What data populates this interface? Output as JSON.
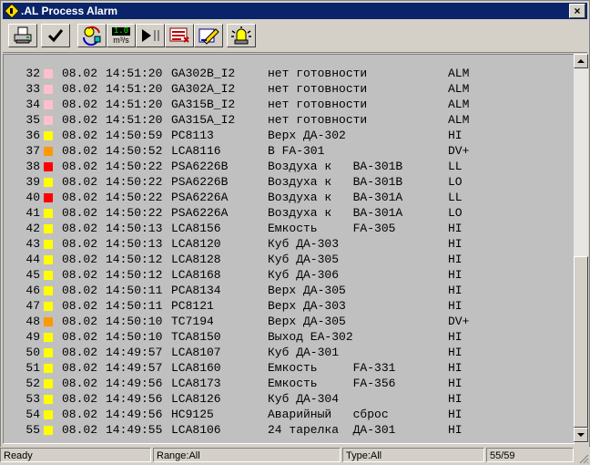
{
  "window": {
    "title": ".AL Process Alarm",
    "close_label": "×"
  },
  "toolbar": {
    "buttons": [
      {
        "name": "print-button",
        "icon": "printer-icon"
      },
      {
        "name": "acknowledge-button",
        "icon": "checkmark-icon"
      },
      {
        "name": "refresh-button",
        "icon": "rotate-arrows-icon"
      },
      {
        "name": "units-button",
        "icon": "units-display-icon",
        "value": "1.0",
        "unit": "m³/s"
      },
      {
        "name": "play-pause-button",
        "icon": "play-pause-icon"
      },
      {
        "name": "alarm-list-button",
        "icon": "list-icon"
      },
      {
        "name": "edit-button",
        "icon": "pencil-icon"
      },
      {
        "name": "alarm-lamp-button",
        "icon": "beacon-icon"
      }
    ]
  },
  "colors": {
    "pink": "#ffc0cb",
    "yellow": "#ffff00",
    "orange": "#ff9900",
    "red": "#ff0000"
  },
  "alarms": [
    {
      "num": "32",
      "color": "pink",
      "date": "08.02",
      "time": "14:51:20",
      "tag": "GA302B_I2",
      "desc": "нет готовности",
      "state": "ALM"
    },
    {
      "num": "33",
      "color": "pink",
      "date": "08.02",
      "time": "14:51:20",
      "tag": "GA302A_I2",
      "desc": "нет готовности",
      "state": "ALM"
    },
    {
      "num": "34",
      "color": "pink",
      "date": "08.02",
      "time": "14:51:20",
      "tag": "GA315B_I2",
      "desc": "нет готовности",
      "state": "ALM"
    },
    {
      "num": "35",
      "color": "pink",
      "date": "08.02",
      "time": "14:51:20",
      "tag": "GA315A_I2",
      "desc": "нет готовности",
      "state": "ALM"
    },
    {
      "num": "36",
      "color": "yellow",
      "date": "08.02",
      "time": "14:50:59",
      "tag": "PC8113",
      "desc": "Верх ДА-302",
      "state": "HI"
    },
    {
      "num": "37",
      "color": "orange",
      "date": "08.02",
      "time": "14:50:52",
      "tag": "LCA8116",
      "desc": "В FA-301",
      "state": "DV+"
    },
    {
      "num": "38",
      "color": "red",
      "date": "08.02",
      "time": "14:50:22",
      "tag": "PSA6226B",
      "desc": "Воздуха к   BA-301B",
      "state": "LL"
    },
    {
      "num": "39",
      "color": "yellow",
      "date": "08.02",
      "time": "14:50:22",
      "tag": "PSA6226B",
      "desc": "Воздуха к   BA-301B",
      "state": "LO"
    },
    {
      "num": "40",
      "color": "red",
      "date": "08.02",
      "time": "14:50:22",
      "tag": "PSA6226A",
      "desc": "Воздуха к   BA-301A",
      "state": "LL"
    },
    {
      "num": "41",
      "color": "yellow",
      "date": "08.02",
      "time": "14:50:22",
      "tag": "PSA6226A",
      "desc": "Воздуха к   BA-301A",
      "state": "LO"
    },
    {
      "num": "42",
      "color": "yellow",
      "date": "08.02",
      "time": "14:50:13",
      "tag": "LCA8156",
      "desc": "Емкость     FA-305",
      "state": "HI"
    },
    {
      "num": "43",
      "color": "yellow",
      "date": "08.02",
      "time": "14:50:13",
      "tag": "LCA8120",
      "desc": "Куб ДА-303",
      "state": "HI"
    },
    {
      "num": "44",
      "color": "yellow",
      "date": "08.02",
      "time": "14:50:12",
      "tag": "LCA8128",
      "desc": "Куб ДА-305",
      "state": "HI"
    },
    {
      "num": "45",
      "color": "yellow",
      "date": "08.02",
      "time": "14:50:12",
      "tag": "LCA8168",
      "desc": "Куб ДА-306",
      "state": "HI"
    },
    {
      "num": "46",
      "color": "yellow",
      "date": "08.02",
      "time": "14:50:11",
      "tag": "PCA8134",
      "desc": "Верх ДА-305",
      "state": "HI"
    },
    {
      "num": "47",
      "color": "yellow",
      "date": "08.02",
      "time": "14:50:11",
      "tag": "PC8121",
      "desc": "Верх ДА-303",
      "state": "HI"
    },
    {
      "num": "48",
      "color": "orange",
      "date": "08.02",
      "time": "14:50:10",
      "tag": "TC7194",
      "desc": "Верх ДА-305",
      "state": "DV+"
    },
    {
      "num": "49",
      "color": "yellow",
      "date": "08.02",
      "time": "14:50:10",
      "tag": "TCA8150",
      "desc": "Выход ЕА-302",
      "state": "HI"
    },
    {
      "num": "50",
      "color": "yellow",
      "date": "08.02",
      "time": "14:49:57",
      "tag": "LCA8107",
      "desc": "Куб ДА-301",
      "state": "HI"
    },
    {
      "num": "51",
      "color": "yellow",
      "date": "08.02",
      "time": "14:49:57",
      "tag": "LCA8160",
      "desc": "Емкость     FA-331",
      "state": "HI"
    },
    {
      "num": "52",
      "color": "yellow",
      "date": "08.02",
      "time": "14:49:56",
      "tag": "LCA8173",
      "desc": "Емкость     FA-356",
      "state": "HI"
    },
    {
      "num": "53",
      "color": "yellow",
      "date": "08.02",
      "time": "14:49:56",
      "tag": "LCA8126",
      "desc": "Куб ДА-304",
      "state": "HI"
    },
    {
      "num": "54",
      "color": "yellow",
      "date": "08.02",
      "time": "14:49:56",
      "tag": "HC9125",
      "desc": "Аварийный   сброс",
      "state": "HI"
    },
    {
      "num": "55",
      "color": "yellow",
      "date": "08.02",
      "time": "14:49:55",
      "tag": "LCA8106",
      "desc": "24 тарелка  ДА-301",
      "state": "HI"
    }
  ],
  "status": {
    "ready": "Ready",
    "range": "Range:All",
    "type": "Type:All",
    "count": "55/59"
  }
}
